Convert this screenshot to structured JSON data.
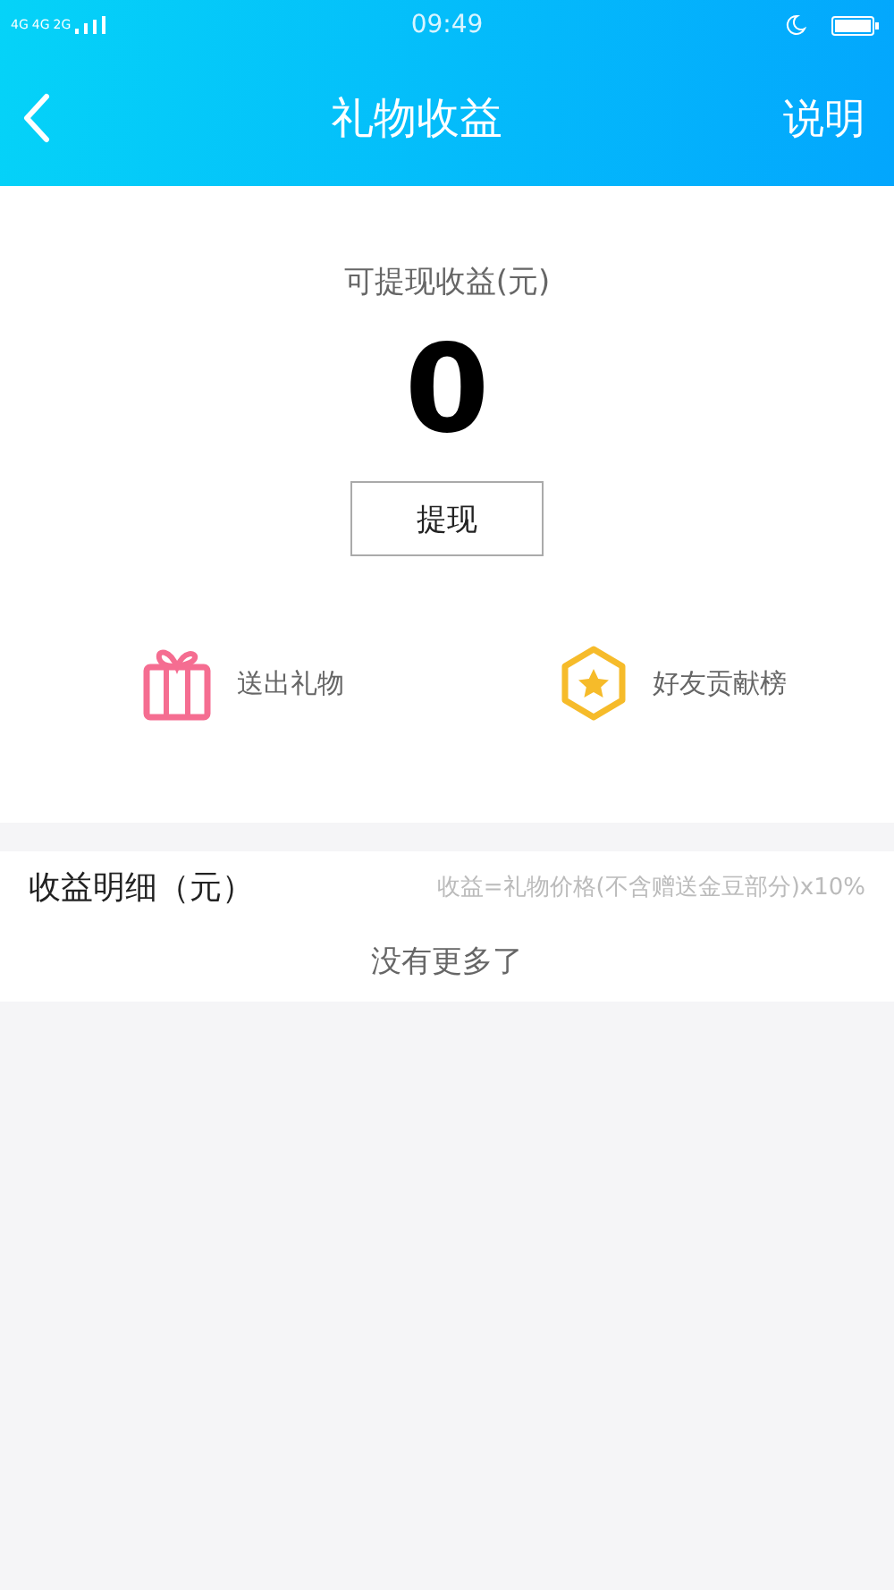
{
  "status_bar": {
    "networks": [
      "4G",
      "4G",
      "2G"
    ],
    "time": "09:49"
  },
  "nav": {
    "title": "礼物收益",
    "action": "说明"
  },
  "balance": {
    "label": "可提现收益(元)",
    "amount": "0",
    "button": "提现"
  },
  "actions": [
    {
      "kind": "gift",
      "label": "送出礼物"
    },
    {
      "kind": "star",
      "label": "好友贡献榜"
    }
  ],
  "details": {
    "title": "收益明细（元）",
    "note": "收益=礼物价格(不含赠送金豆部分)x10%",
    "empty": "没有更多了"
  }
}
